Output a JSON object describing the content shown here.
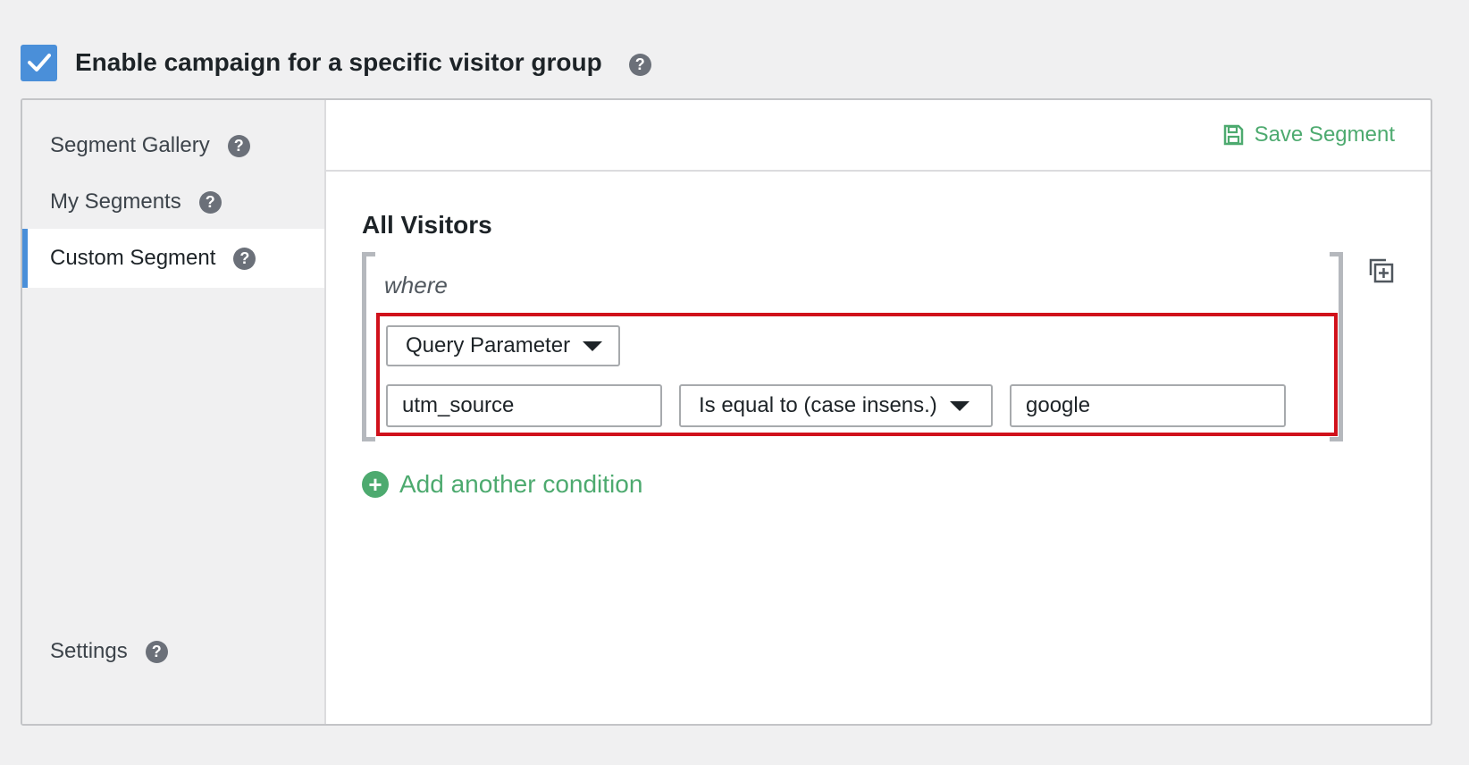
{
  "header": {
    "enable_label": "Enable campaign for a specific visitor group",
    "enable_checked": true,
    "help_glyph": "?"
  },
  "sidebar": {
    "items": [
      {
        "label": "Segment Gallery",
        "active": false
      },
      {
        "label": "My Segments",
        "active": false
      },
      {
        "label": "Custom Segment",
        "active": true
      }
    ],
    "settings_label": "Settings"
  },
  "main": {
    "save_label": "Save Segment",
    "title": "All Visitors",
    "where_label": "where",
    "condition": {
      "type_select": "Query Parameter",
      "param_value": "utm_source",
      "operator_select": "Is equal to (case insens.)",
      "match_value": "google"
    },
    "add_condition_label": "Add another condition"
  },
  "colors": {
    "accent_blue": "#4a8fd9",
    "success_green": "#4daa6f",
    "highlight_red": "#d0111b",
    "help_gray": "#6b7079"
  },
  "icons": {
    "checkbox": "checkmark-icon",
    "help": "help-icon",
    "save": "floppy-disk-icon",
    "duplicate": "duplicate-add-icon",
    "add": "plus-circle-icon"
  }
}
